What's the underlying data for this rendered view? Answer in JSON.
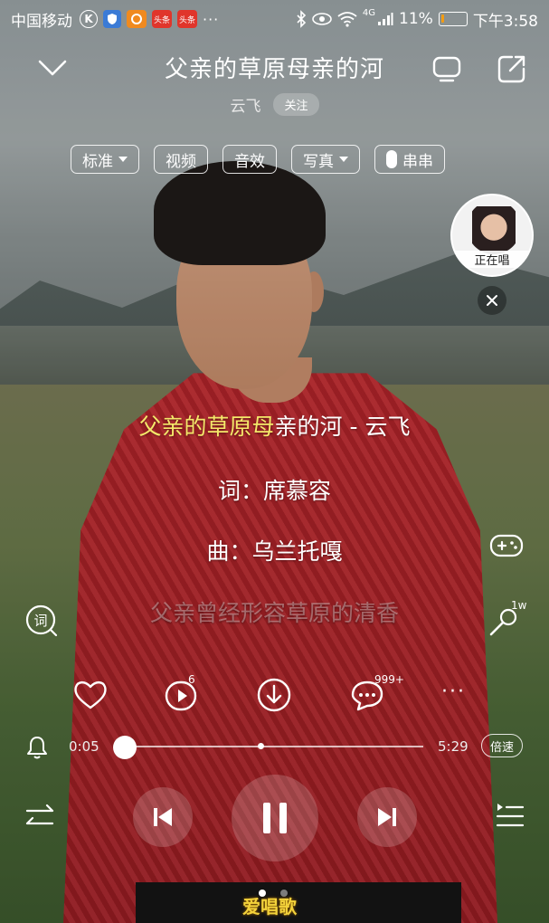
{
  "status_bar": {
    "carrier": "中国移动",
    "k_icon": "K",
    "toutiao_label": "头条",
    "more": "···",
    "network": "4G",
    "battery_percent": "11%",
    "battery_level": 0.11,
    "time": "下午3:58",
    "colors": {
      "battery_fill": "#f39c12"
    }
  },
  "header": {
    "title": "父亲的草原母亲的河",
    "artist": "云飞",
    "follow_label": "关注"
  },
  "chips": {
    "standard": "标准",
    "video": "视频",
    "sound_effect": "音效",
    "photo": "写真",
    "chuanchuan": "串串"
  },
  "singing_bubble": {
    "label": "正在唱"
  },
  "lyrics": {
    "line1_highlight": "父亲的草原母",
    "line1_rest": "亲的河 - 云飞",
    "line2": "词：席慕容",
    "line3": "曲：乌兰托嘎",
    "line4": "父亲曾经形容草原的清香"
  },
  "side_icons": {
    "lyrics_label": "词",
    "karaoke_count": "1w"
  },
  "actions": {
    "video_badge": "6",
    "comment_badge": "999+",
    "more": "···"
  },
  "progress": {
    "current_time": "0:05",
    "total_time": "5:29",
    "fraction": 0.016,
    "speed_label": "倍速"
  },
  "watermark": "爱唱歌",
  "colors": {
    "lyric_highlight": "#f5e86a",
    "watermark": "#f3d23b"
  }
}
